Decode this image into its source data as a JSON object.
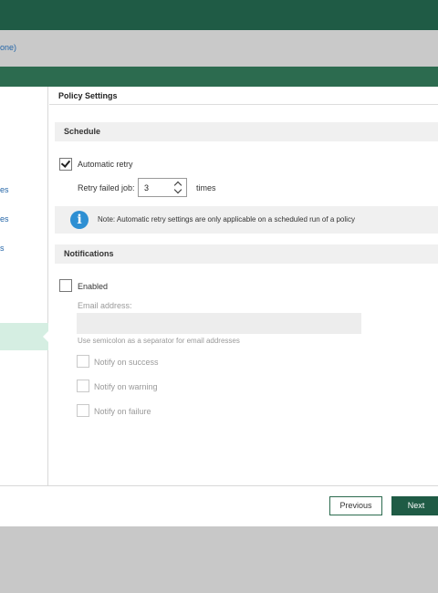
{
  "subbar": {
    "title": "one)"
  },
  "sidebar": {
    "items": [
      {
        "label": "es"
      },
      {
        "label": "es"
      },
      {
        "label": "s"
      }
    ]
  },
  "panel": {
    "title": "Policy Settings"
  },
  "schedule": {
    "header": "Schedule",
    "auto_retry_label": "Automatic retry",
    "auto_retry_checked": true,
    "retry_label": "Retry failed job:",
    "retry_value": "3",
    "retry_unit": "times",
    "note": "Note: Automatic retry settings are only applicable on a scheduled run of a policy"
  },
  "notifications": {
    "header": "Notifications",
    "enabled_label": "Enabled",
    "enabled_checked": false,
    "email_label": "Email address:",
    "email_value": "",
    "email_hint": "Use semicolon as a separator for email addresses",
    "options": [
      {
        "label": "Notify on success"
      },
      {
        "label": "Notify on warning"
      },
      {
        "label": "Notify on failure"
      }
    ]
  },
  "footer": {
    "previous": "Previous",
    "next": "Next"
  },
  "colors": {
    "brand_dark": "#1f5b45",
    "brand": "#2c6b4f",
    "link": "#2566a8",
    "info": "#2e8fd3"
  },
  "icons": {
    "info": "info-icon",
    "check": "check-icon"
  }
}
